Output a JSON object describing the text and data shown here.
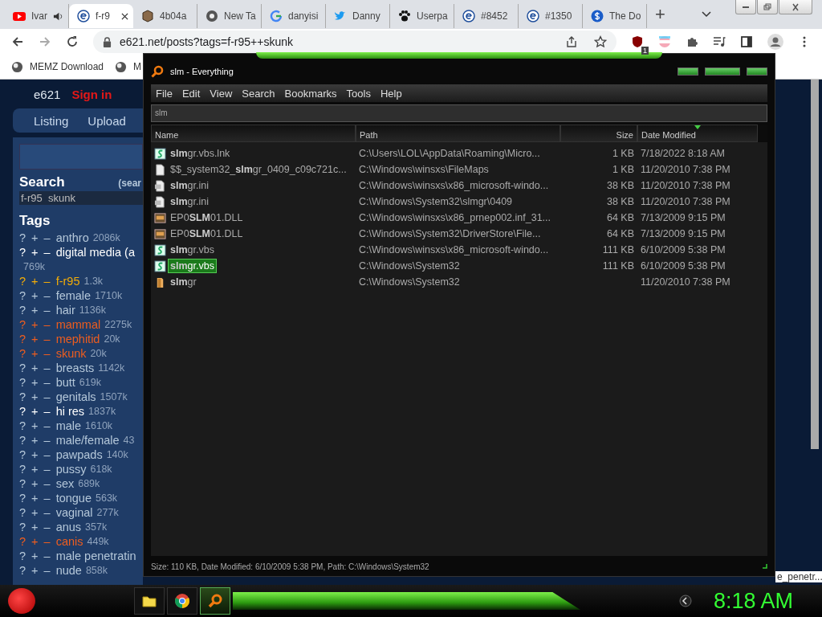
{
  "browser": {
    "tabs": [
      {
        "label": "Ivar",
        "kind": "play",
        "selected": false,
        "audio": true
      },
      {
        "label": "f-r9",
        "kind": "letter-e",
        "selected": true,
        "audio": false
      },
      {
        "label": "4b04a",
        "kind": "cube",
        "selected": false,
        "audio": false
      },
      {
        "label": "New Ta",
        "kind": "globe",
        "selected": false,
        "audio": false
      },
      {
        "label": "danyisi",
        "kind": "letter-g",
        "selected": false,
        "audio": false
      },
      {
        "label": "Danny",
        "kind": "bird",
        "selected": false,
        "audio": false
      },
      {
        "label": "Userpa",
        "kind": "paw",
        "selected": false,
        "audio": false
      },
      {
        "label": "#8452",
        "kind": "letter-e",
        "selected": false,
        "audio": false
      },
      {
        "label": "#1350",
        "kind": "letter-e",
        "selected": false,
        "audio": false
      },
      {
        "label": "The Do",
        "kind": "dollar",
        "selected": false,
        "audio": false
      }
    ],
    "new_tab": "+",
    "address": "e621.net/posts?tags=f-r95++skunk",
    "extension_badge": "1",
    "bookmarks": [
      "MEMZ Download",
      "M"
    ]
  },
  "page": {
    "site_name": "e621",
    "sign_in": "Sign in",
    "nav": [
      "Listing",
      "Upload"
    ],
    "search_heading": "Search",
    "search_hint": "(sear",
    "search_value": "f-r95  skunk",
    "tags_heading": "Tags",
    "tags": [
      {
        "name": "anthro",
        "count": "2086k",
        "kind": "general"
      },
      {
        "name": "digital media (a",
        "count": "769k",
        "kind": "meta"
      },
      {
        "name": "f-r95",
        "count": "1.3k",
        "kind": "artist"
      },
      {
        "name": "female",
        "count": "1710k",
        "kind": "general"
      },
      {
        "name": "hair",
        "count": "1136k",
        "kind": "general"
      },
      {
        "name": "mammal",
        "count": "2275k",
        "kind": "species"
      },
      {
        "name": "mephitid",
        "count": "20k",
        "kind": "species"
      },
      {
        "name": "skunk",
        "count": "20k",
        "kind": "species"
      },
      {
        "name": "breasts",
        "count": "1142k",
        "kind": "general"
      },
      {
        "name": "butt",
        "count": "619k",
        "kind": "general"
      },
      {
        "name": "genitals",
        "count": "1507k",
        "kind": "general"
      },
      {
        "name": "hi res",
        "count": "1837k",
        "kind": "meta"
      },
      {
        "name": "male",
        "count": "1610k",
        "kind": "general"
      },
      {
        "name": "male/female",
        "count": "43",
        "kind": "general"
      },
      {
        "name": "pawpads",
        "count": "140k",
        "kind": "general"
      },
      {
        "name": "pussy",
        "count": "618k",
        "kind": "general"
      },
      {
        "name": "sex",
        "count": "689k",
        "kind": "general"
      },
      {
        "name": "tongue",
        "count": "563k",
        "kind": "general"
      },
      {
        "name": "vaginal",
        "count": "277k",
        "kind": "general"
      },
      {
        "name": "anus",
        "count": "357k",
        "kind": "general"
      },
      {
        "name": "canis",
        "count": "449k",
        "kind": "species"
      },
      {
        "name": "male penetratin",
        "kind": "general"
      },
      {
        "name": "nude",
        "count": "858k",
        "kind": "general"
      }
    ],
    "tag_marks": [
      "?",
      "+",
      "–"
    ],
    "side_fragment": "e_penetr..."
  },
  "everything": {
    "title": "slm - Everything",
    "menu": [
      "File",
      "Edit",
      "View",
      "Search",
      "Bookmarks",
      "Tools",
      "Help"
    ],
    "search": "slm",
    "columns": [
      "Name",
      "Path",
      "Size",
      "Date Modified"
    ],
    "rows": [
      {
        "name": "**slm**gr.vbs.lnk",
        "path": "C:\\Users\\LOL\\AppData\\Roaming\\Micro...",
        "size": "1 KB",
        "date": "7/18/2022 8:18 AM",
        "kind": "script",
        "selected": false
      },
      {
        "name": "$$_system32_**slm**gr_0409_c09c721c...",
        "path": "C:\\Windows\\winsxs\\FileMaps",
        "size": "1 KB",
        "date": "11/20/2010 7:38 PM",
        "kind": "file",
        "selected": false
      },
      {
        "name": "**slm**gr.ini",
        "path": "C:\\Windows\\winsxs\\x86_microsoft-windo...",
        "size": "38 KB",
        "date": "11/20/2010 7:38 PM",
        "kind": "settings",
        "selected": false
      },
      {
        "name": "**slm**gr.ini",
        "path": "C:\\Windows\\System32\\slmgr\\0409",
        "size": "38 KB",
        "date": "11/20/2010 7:38 PM",
        "kind": "settings",
        "selected": false
      },
      {
        "name": "EP0**SLM**01.DLL",
        "path": "C:\\Windows\\winsxs\\x86_prnep002.inf_31...",
        "size": "64 KB",
        "date": "7/13/2009 9:15 PM",
        "kind": "library",
        "selected": false
      },
      {
        "name": "EP0**SLM**01.DLL",
        "path": "C:\\Windows\\System32\\DriverStore\\File...",
        "size": "64 KB",
        "date": "7/13/2009 9:15 PM",
        "kind": "library",
        "selected": false
      },
      {
        "name": "**slm**gr.vbs",
        "path": "C:\\Windows\\winsxs\\x86_microsoft-windo...",
        "size": "111 KB",
        "date": "6/10/2009 5:38 PM",
        "kind": "script",
        "selected": false
      },
      {
        "name": "**slm**gr.vbs",
        "path": "C:\\Windows\\System32",
        "size": "111 KB",
        "date": "6/10/2009 5:38 PM",
        "kind": "script",
        "selected": true
      },
      {
        "name": "**slm**gr",
        "path": "C:\\Windows\\System32",
        "date": "11/20/2010 7:38 PM",
        "kind": "folder",
        "selected": false
      }
    ],
    "status": "Size: 110 KB, Date Modified: 6/10/2009 5:38 PM, Path: C:\\Windows\\System32"
  },
  "taskbar": {
    "apps": [
      {
        "kind": "folder",
        "selected": false
      },
      {
        "kind": "browser",
        "selected": false
      },
      {
        "kind": "search",
        "selected": true
      }
    ],
    "clock": "8:18 AM"
  }
}
